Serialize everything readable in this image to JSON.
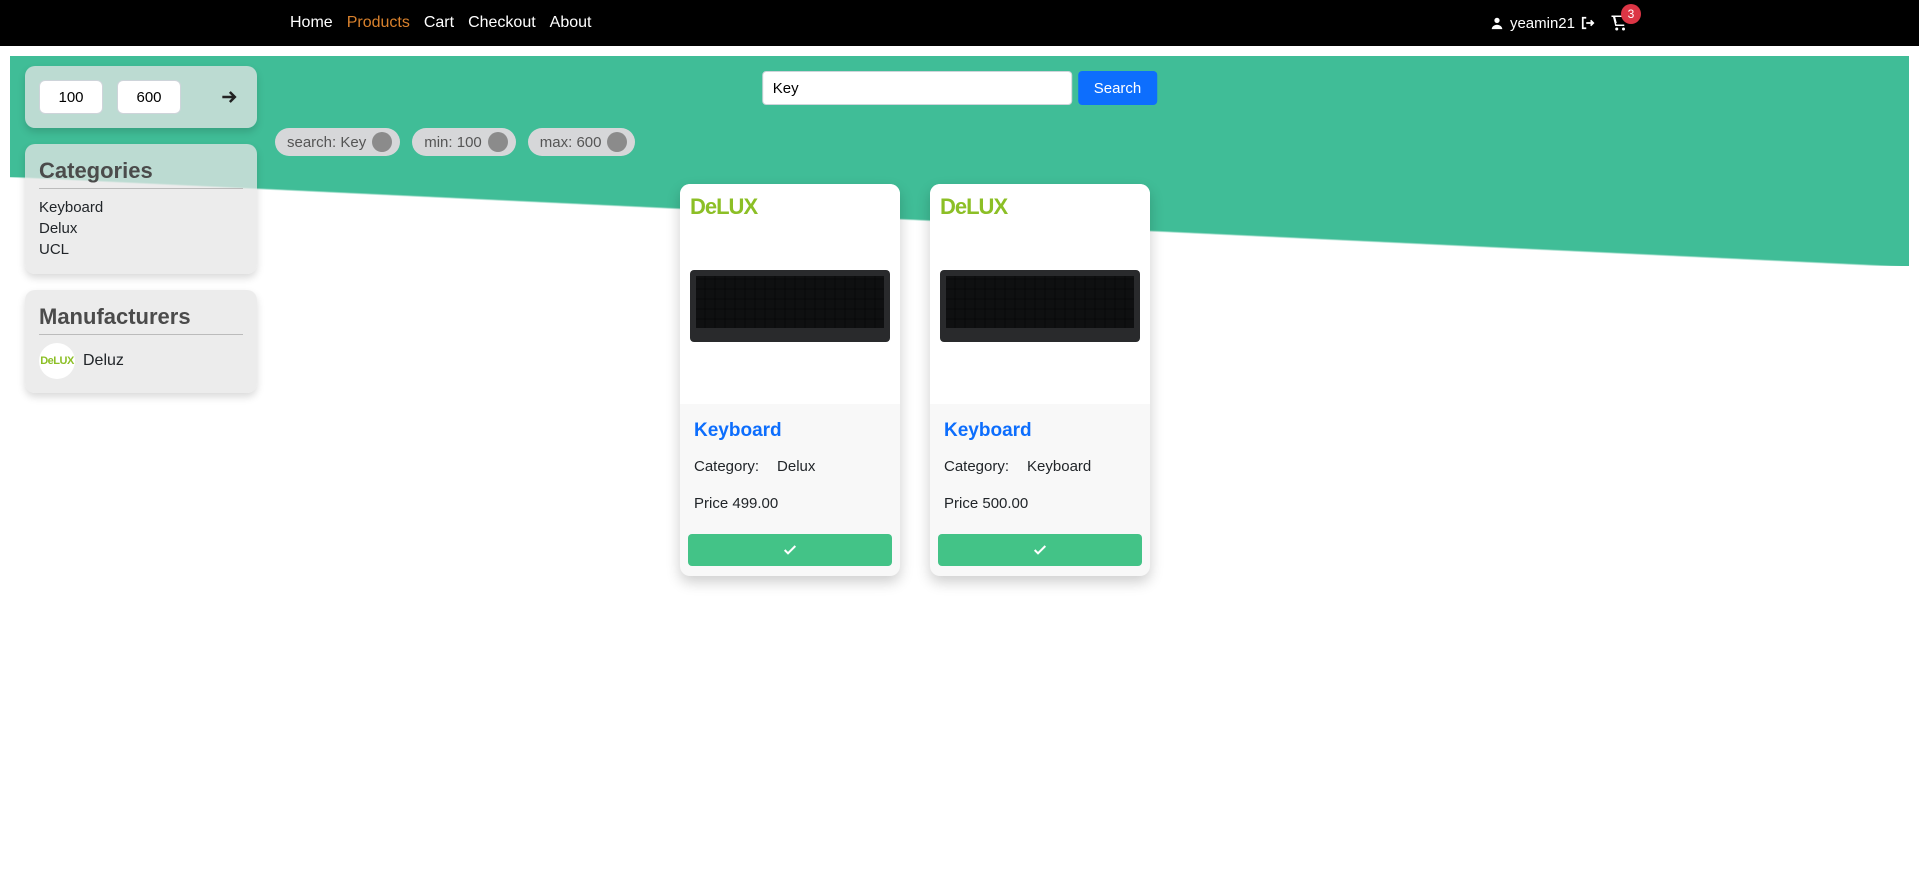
{
  "nav": {
    "items": [
      {
        "label": "Home",
        "active": false
      },
      {
        "label": "Products",
        "active": true
      },
      {
        "label": "Cart",
        "active": false
      },
      {
        "label": "Checkout",
        "active": false
      },
      {
        "label": "About",
        "active": false
      }
    ],
    "username": "yeamin21",
    "cart_count": "3"
  },
  "search": {
    "value": "Key",
    "button": "Search"
  },
  "price_filter": {
    "min": "100",
    "max": "600"
  },
  "chips": [
    {
      "label": "search: Key"
    },
    {
      "label": "min: 100"
    },
    {
      "label": "max: 600"
    }
  ],
  "sidebar": {
    "categories_title": "Categories",
    "categories": [
      "Keyboard",
      "Delux",
      "UCL"
    ],
    "manufacturers_title": "Manufacturers",
    "manufacturers": [
      {
        "name": "Deluz",
        "logo": "DeLUX"
      }
    ]
  },
  "products": [
    {
      "brand_logo": "DeLUX",
      "name": "Keyboard",
      "category_label": "Category:",
      "category": "Delux",
      "price_label": "Price",
      "price": "499.00"
    },
    {
      "brand_logo": "DeLUX",
      "name": "Keyboard",
      "category_label": "Category:",
      "category": "Keyboard",
      "price_label": "Price",
      "price": "500.00"
    }
  ]
}
